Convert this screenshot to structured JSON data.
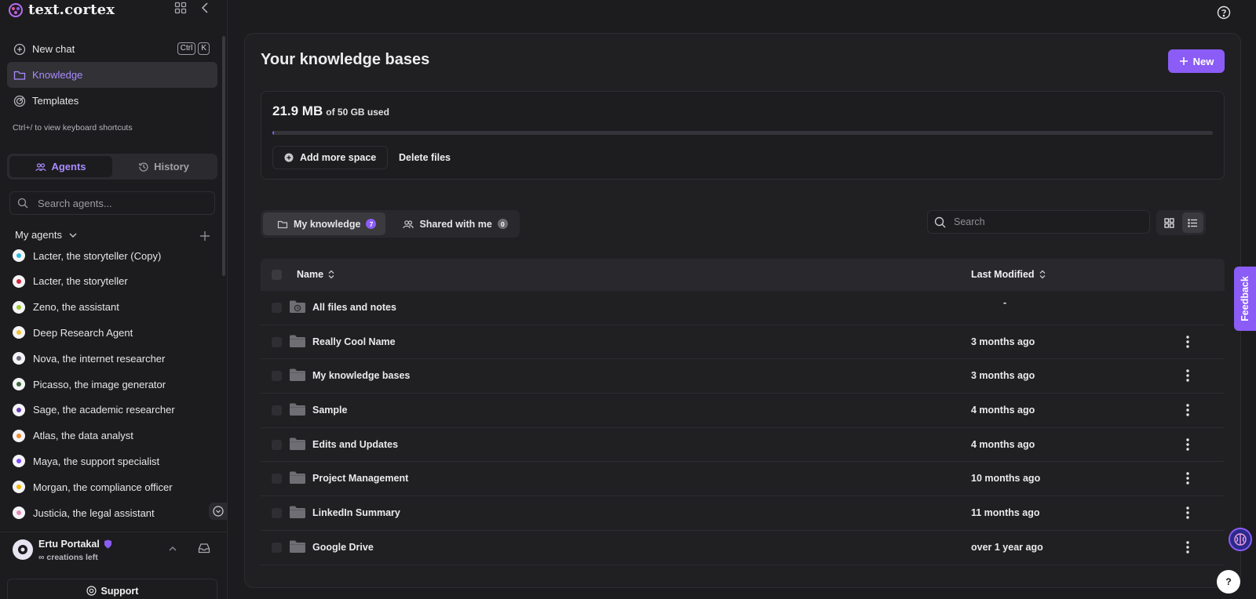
{
  "app": {
    "logo_text": "text.cortex"
  },
  "nav": {
    "new_chat": "New chat",
    "kbd_ctrl": "Ctrl",
    "kbd_k": "K",
    "knowledge": "Knowledge",
    "templates": "Templates",
    "shortcut_hint": "Ctrl+/ to view keyboard shortcuts"
  },
  "sidebar_tabs": {
    "agents": "Agents",
    "history": "History",
    "active": "agents"
  },
  "agent_search": {
    "placeholder": "Search agents..."
  },
  "my_agents_label": "My agents",
  "agents": [
    {
      "name": "Lacter, the storyteller (Copy)",
      "color": "#2bb8e0"
    },
    {
      "name": "Lacter, the storyteller",
      "color": "#d6263b"
    },
    {
      "name": "Zeno, the assistant",
      "color": "#9ccc2e"
    },
    {
      "name": "Deep Research Agent",
      "color": "#f2c230"
    },
    {
      "name": "Nova, the internet researcher",
      "color": "#6b6b80"
    },
    {
      "name": "Picasso, the image generator",
      "color": "#3a6b3a"
    },
    {
      "name": "Sage, the academic researcher",
      "color": "#6a3fb5"
    },
    {
      "name": "Atlas, the data analyst",
      "color": "#f08a24"
    },
    {
      "name": "Maya, the support specialist",
      "color": "#7c4dff"
    },
    {
      "name": "Morgan, the compliance officer",
      "color": "#f5b800"
    },
    {
      "name": "Justicia, the legal assistant",
      "color": "#e88ab6"
    }
  ],
  "user": {
    "name": "Ertu Portakal",
    "sub": "∞ creations left"
  },
  "support_label": "Support",
  "main": {
    "title": "Your knowledge bases",
    "new_button": "New",
    "storage": {
      "used": "21.9 MB",
      "of_label": "of 50 GB used",
      "fraction_used": 0.0005,
      "add_space": "Add more space",
      "delete_files": "Delete files"
    },
    "tabs": {
      "mine": "My knowledge",
      "mine_count": "7",
      "shared": "Shared with me",
      "shared_count": "0"
    },
    "search": {
      "placeholder": "Search"
    },
    "view_mode": "list",
    "columns": {
      "name": "Name",
      "modified": "Last Modified"
    },
    "rows": [
      {
        "name": "All files and notes",
        "modified": "-",
        "icon": "all-files-icon"
      },
      {
        "name": "Really Cool Name",
        "modified": "3 months ago",
        "icon": "folder-icon"
      },
      {
        "name": "My knowledge bases",
        "modified": "3 months ago",
        "icon": "folder-icon"
      },
      {
        "name": "Sample",
        "modified": "4 months ago",
        "icon": "folder-icon"
      },
      {
        "name": "Edits and Updates",
        "modified": "4 months ago",
        "icon": "folder-icon"
      },
      {
        "name": "Project Management",
        "modified": "10 months ago",
        "icon": "folder-icon"
      },
      {
        "name": "LinkedIn Summary",
        "modified": "11 months ago",
        "icon": "folder-icon"
      },
      {
        "name": "Google Drive",
        "modified": "over 1 year ago",
        "icon": "folder-icon"
      }
    ]
  },
  "feedback_label": "Feedback",
  "help_glyph": "?",
  "colors": {
    "accent": "#8b5cf6",
    "background": "#1c1c1f",
    "panel": "#202023"
  }
}
